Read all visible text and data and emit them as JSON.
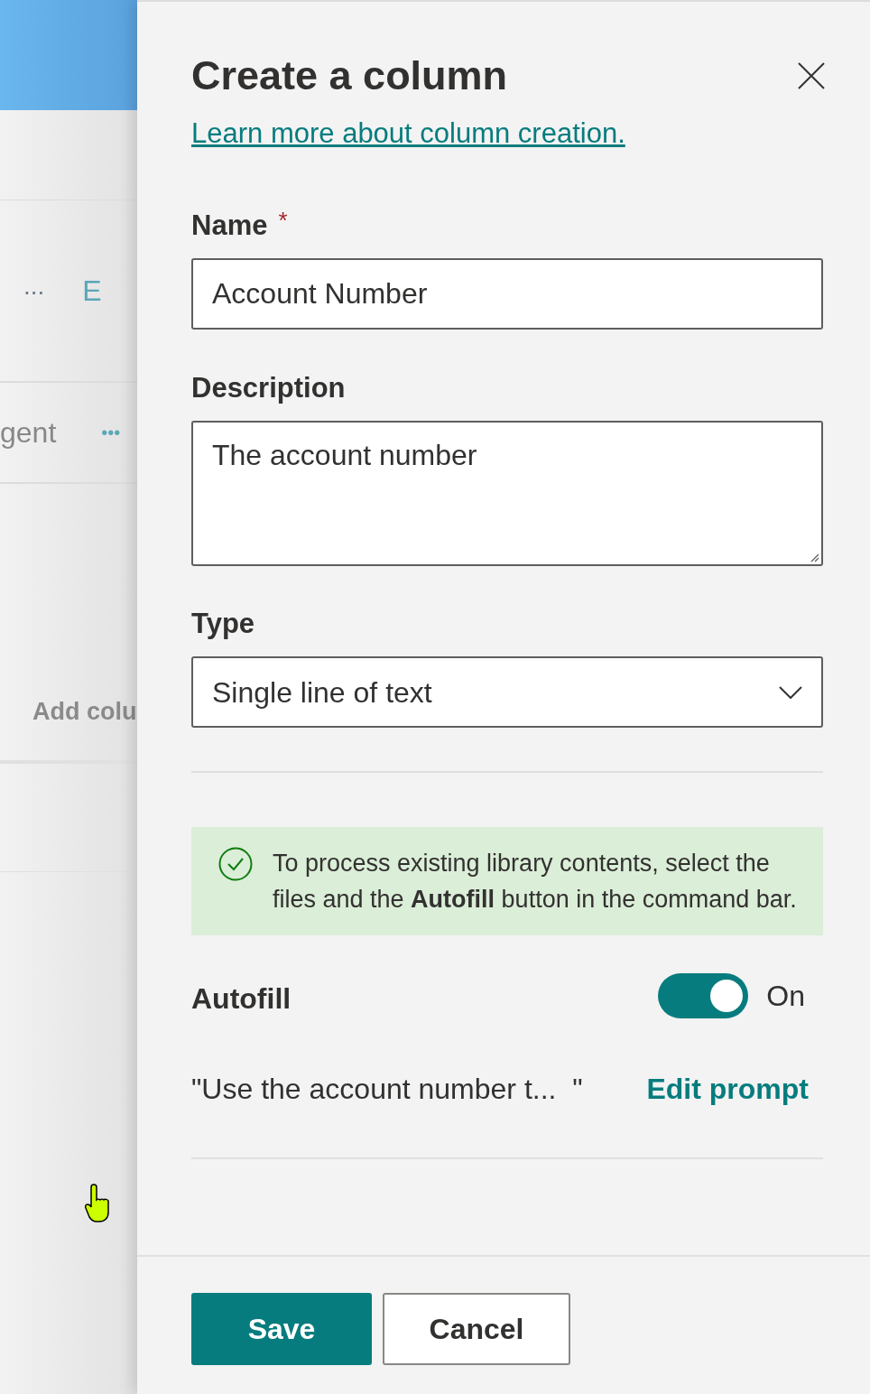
{
  "background": {
    "row_1": {
      "more": "...",
      "column_text": "E"
    },
    "row_2": {
      "column_text": "gent",
      "more": "•••"
    },
    "add_column": "Add colu"
  },
  "panel": {
    "title": "Create a column",
    "learn_more_link": "Learn more about column creation.",
    "fields": [
      {
        "kind": "text",
        "label": "Name",
        "required_mark": "*",
        "value": "Account Number"
      },
      {
        "kind": "textarea",
        "label": "Description",
        "value": "The account number"
      },
      {
        "kind": "dropdown",
        "label": "Type",
        "value": "Single line of text"
      }
    ],
    "info_message": "To process existing library contents, select the files and the **Autofill** button in the command bar.",
    "autofill": {
      "label": "Autofill",
      "on": true,
      "state_text": "On",
      "prompt": "\"Use the account number t...  \"",
      "edit_link": "Edit prompt"
    },
    "buttons": [
      {
        "label": "Save",
        "kind": "primary"
      },
      {
        "label": "Cancel",
        "kind": "secondary"
      }
    ]
  }
}
